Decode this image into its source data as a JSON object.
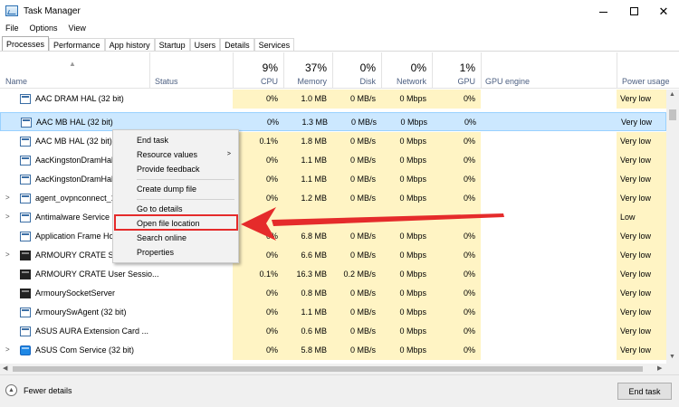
{
  "window": {
    "title": "Task Manager"
  },
  "menu": [
    "File",
    "Options",
    "View"
  ],
  "tabs": [
    "Processes",
    "Performance",
    "App history",
    "Startup",
    "Users",
    "Details",
    "Services"
  ],
  "columns": {
    "name": "Name",
    "status": "Status",
    "cpu": {
      "pct": "9%",
      "label": "CPU"
    },
    "memory": {
      "pct": "37%",
      "label": "Memory"
    },
    "disk": {
      "pct": "0%",
      "label": "Disk"
    },
    "network": {
      "pct": "0%",
      "label": "Network"
    },
    "gpu": {
      "pct": "1%",
      "label": "GPU"
    },
    "gpu_engine": "GPU engine",
    "power": "Power usage"
  },
  "rows": [
    {
      "name": "AAC DRAM HAL (32 bit)",
      "cpu": "0%",
      "mem": "1.0 MB",
      "disk": "0 MB/s",
      "net": "0 Mbps",
      "gpu": "0%",
      "power": "Very low"
    },
    {
      "name": "AAC MB HAL (32 bit)",
      "cpu": "0%",
      "mem": "1.3 MB",
      "disk": "0 MB/s",
      "net": "0 Mbps",
      "gpu": "0%",
      "power": "Very low"
    },
    {
      "name": "AAC MB HAL (32 bit)",
      "cpu": "0.1%",
      "mem": "1.8 MB",
      "disk": "0 MB/s",
      "net": "0 Mbps",
      "gpu": "0%",
      "power": "Very low"
    },
    {
      "name": "AacKingstonDramHal",
      "cpu": "0%",
      "mem": "1.1 MB",
      "disk": "0 MB/s",
      "net": "0 Mbps",
      "gpu": "0%",
      "power": "Very low"
    },
    {
      "name": "AacKingstonDramHal",
      "cpu": "0%",
      "mem": "1.1 MB",
      "disk": "0 MB/s",
      "net": "0 Mbps",
      "gpu": "0%",
      "power": "Very low"
    },
    {
      "name": "agent_ovpnconnect_1",
      "cpu": "0%",
      "mem": "1.2 MB",
      "disk": "0 MB/s",
      "net": "0 Mbps",
      "gpu": "0%",
      "power": "Very low"
    },
    {
      "name": "Antimalware Service E",
      "cpu": "",
      "mem": "",
      "disk": "",
      "net": "",
      "gpu": "",
      "power": "Low"
    },
    {
      "name": "Application Frame Ho",
      "cpu": "0%",
      "mem": "6.8 MB",
      "disk": "0 MB/s",
      "net": "0 Mbps",
      "gpu": "0%",
      "power": "Very low"
    },
    {
      "name": "ARMOURY CRATE Ser",
      "cpu": "0%",
      "mem": "6.6 MB",
      "disk": "0 MB/s",
      "net": "0 Mbps",
      "gpu": "0%",
      "power": "Very low"
    },
    {
      "name": "ARMOURY CRATE User Sessio...",
      "cpu": "0.1%",
      "mem": "16.3 MB",
      "disk": "0.2 MB/s",
      "net": "0 Mbps",
      "gpu": "0%",
      "power": "Very low"
    },
    {
      "name": "ArmourySocketServer",
      "cpu": "0%",
      "mem": "0.8 MB",
      "disk": "0 MB/s",
      "net": "0 Mbps",
      "gpu": "0%",
      "power": "Very low"
    },
    {
      "name": "ArmourySwAgent (32 bit)",
      "cpu": "0%",
      "mem": "1.1 MB",
      "disk": "0 MB/s",
      "net": "0 Mbps",
      "gpu": "0%",
      "power": "Very low"
    },
    {
      "name": "ASUS AURA Extension Card ...",
      "cpu": "0%",
      "mem": "0.6 MB",
      "disk": "0 MB/s",
      "net": "0 Mbps",
      "gpu": "0%",
      "power": "Very low"
    },
    {
      "name": "ASUS Com Service (32 bit)",
      "cpu": "0%",
      "mem": "5.8 MB",
      "disk": "0 MB/s",
      "net": "0 Mbps",
      "gpu": "0%",
      "power": "Very low"
    }
  ],
  "context_menu": {
    "items": [
      "End task",
      "Resource values",
      "Provide feedback",
      "Create dump file",
      "Go to details",
      "Open file location",
      "Search online",
      "Properties"
    ]
  },
  "footer": {
    "fewer_details": "Fewer details",
    "end_task": "End task"
  },
  "colors": {
    "highlight": "#e52b2b",
    "selected_row": "#cce8ff",
    "usage_cell": "#fff4c4"
  }
}
